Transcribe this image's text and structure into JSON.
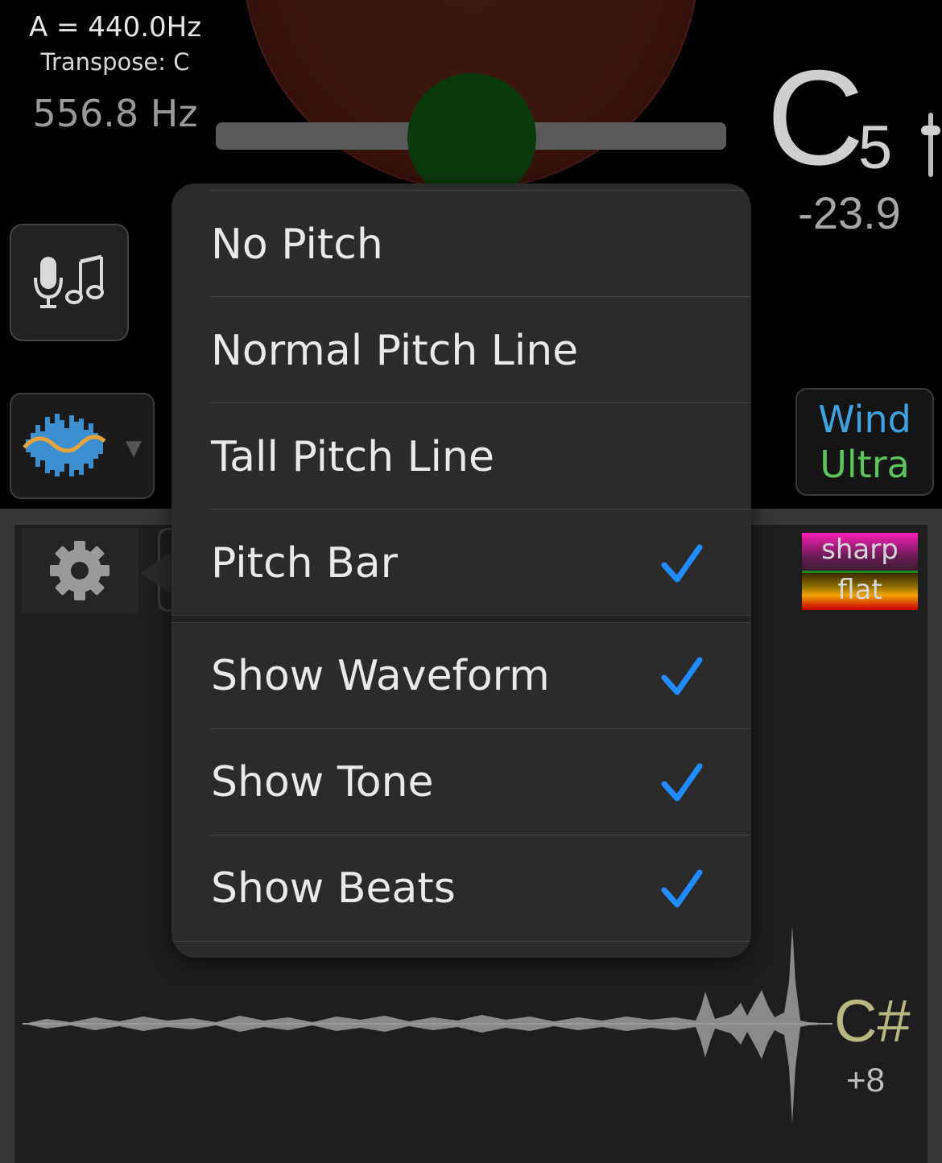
{
  "tuner": {
    "reference": "A = 440.0Hz",
    "transpose": "Transpose: C",
    "frequency": "556.8 Hz",
    "note": "C",
    "octave": "5",
    "cents": "-23.9"
  },
  "instrument": {
    "line1": "Wind",
    "line2": "Ultra"
  },
  "legend": {
    "sharp": "sharp",
    "flat": "flat"
  },
  "detected": {
    "note": "C#",
    "cents": "+8"
  },
  "menu": {
    "items": [
      {
        "label": "No Pitch",
        "checked": false
      },
      {
        "label": "Normal Pitch Line",
        "checked": false
      },
      {
        "label": "Tall Pitch Line",
        "checked": false
      },
      {
        "label": "Pitch Bar",
        "checked": true
      },
      {
        "label": "Show Waveform",
        "checked": true
      },
      {
        "label": "Show Tone",
        "checked": true
      },
      {
        "label": "Show Beats",
        "checked": true
      }
    ]
  },
  "colors": {
    "checkmark": "#1f8cff",
    "wind": "#3ea3e0",
    "ultra": "#5cc45a",
    "detected_note": "#b8b880"
  },
  "icons": [
    "microphone-icon",
    "music-note-icon",
    "waveform-icon",
    "gear-icon",
    "checkmark-icon",
    "chevron-down-icon"
  ]
}
